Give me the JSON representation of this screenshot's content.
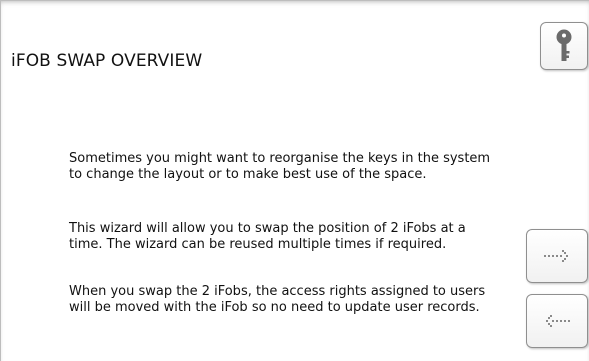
{
  "page": {
    "title": "iFOB SWAP OVERVIEW"
  },
  "content": {
    "paragraphs": [
      {
        "lines": [
          "Sometimes you might want to reorganise the keys in the system",
          "to change the layout or to make best use of the space."
        ]
      },
      {
        "lines": [
          "This wizard will allow you to swap the position of 2 iFobs at a",
          "time.  The wizard can be reused multiple times if required."
        ]
      },
      {
        "lines": [
          "When you swap the 2 iFobs, the access rights assigned to users",
          "will be moved with the iFob so no need to update user records."
        ]
      }
    ]
  },
  "buttons": {
    "key": {
      "icon": "key-icon"
    },
    "next": {
      "icon": "dotted-arrow-right-icon"
    },
    "back": {
      "icon": "dotted-arrow-left-icon"
    }
  }
}
